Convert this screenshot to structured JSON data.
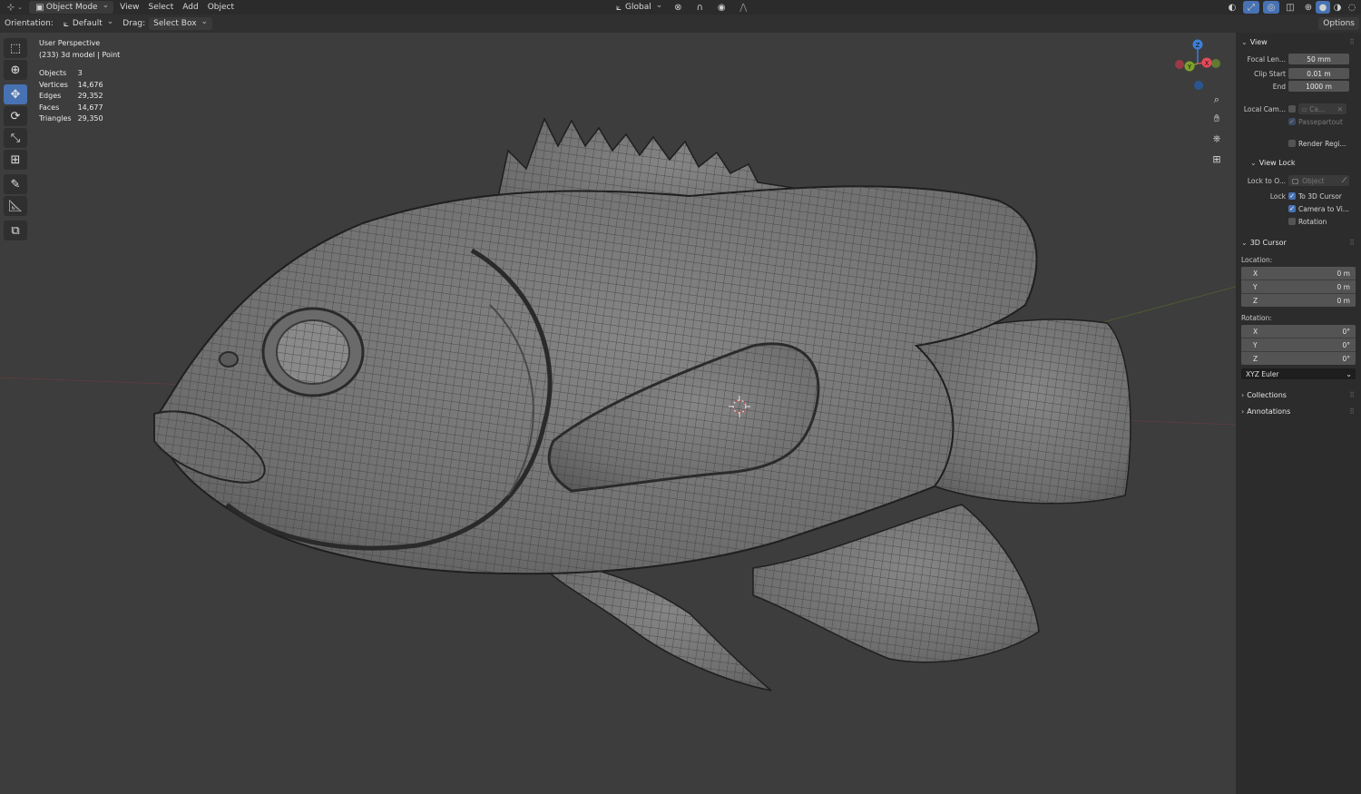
{
  "header": {
    "mode": "Object Mode",
    "menus": [
      "View",
      "Select",
      "Add",
      "Object"
    ],
    "transform_orientation": "Global",
    "options_label": "Options"
  },
  "tool_settings": {
    "orientation_label": "Orientation:",
    "orientation_value": "Default",
    "drag_label": "Drag:",
    "drag_value": "Select Box"
  },
  "overlay": {
    "view_name": "User Perspective",
    "object_info": "(233) 3d model | Point",
    "stats": [
      {
        "label": "Objects",
        "value": "3"
      },
      {
        "label": "Vertices",
        "value": "14,676"
      },
      {
        "label": "Edges",
        "value": "29,352"
      },
      {
        "label": "Faces",
        "value": "14,677"
      },
      {
        "label": "Triangles",
        "value": "29,350"
      }
    ]
  },
  "gizmo": {
    "x": "X",
    "y": "Y",
    "z": "Z"
  },
  "n_panel": {
    "view": {
      "title": "View",
      "focal_label": "Focal Len...",
      "focal_value": "50 mm",
      "clip_start_label": "Clip Start",
      "clip_start_value": "0.01 m",
      "clip_end_label": "End",
      "clip_end_value": "1000 m",
      "local_camera_label": "Local Cam...",
      "local_camera_value": "Ca...",
      "passepartout": "Passepartout",
      "render_region": "Render Regi..."
    },
    "view_lock": {
      "title": "View Lock",
      "lock_object_label": "Lock to O...",
      "lock_object_placeholder": "Object",
      "lock_label": "Lock",
      "to_cursor": "To 3D Cursor",
      "camera_to_view": "Camera to Vi...",
      "rotation": "Rotation"
    },
    "cursor": {
      "title": "3D Cursor",
      "location_label": "Location:",
      "location": [
        {
          "axis": "X",
          "value": "0 m"
        },
        {
          "axis": "Y",
          "value": "0 m"
        },
        {
          "axis": "Z",
          "value": "0 m"
        }
      ],
      "rotation_label": "Rotation:",
      "rotation": [
        {
          "axis": "X",
          "value": "0°"
        },
        {
          "axis": "Y",
          "value": "0°"
        },
        {
          "axis": "Z",
          "value": "0°"
        }
      ],
      "rotation_mode": "XYZ Euler"
    },
    "collections_title": "Collections",
    "annotations_title": "Annotations"
  },
  "colors": {
    "accent": "#4772b3",
    "axis_x": "#e34a5a",
    "axis_y": "#7ea22a",
    "axis_z": "#3c7fd7",
    "viewport_bg": "#3d3d3d"
  }
}
